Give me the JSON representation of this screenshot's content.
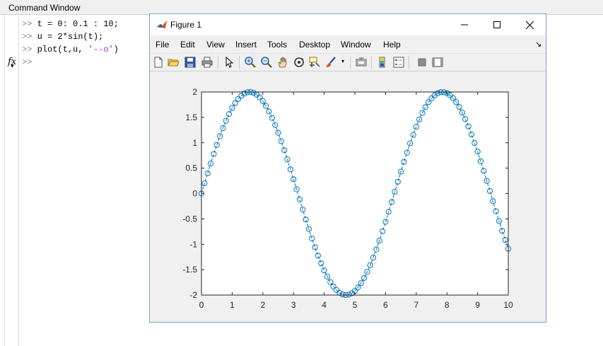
{
  "command_window": {
    "title": "Command Window",
    "prompt": ">>",
    "lines": [
      {
        "code": "t = 0: 0.1 : 10;",
        "code_pre": "",
        "string_part": "",
        "code_post": ""
      },
      {
        "code": "u = 2*sin(t);",
        "code_pre": "",
        "string_part": "",
        "code_post": ""
      },
      {
        "code": "",
        "code_pre": "plot(t,u, ",
        "string_part": "'--o'",
        "code_post": ")"
      }
    ],
    "fx_label": "fx"
  },
  "figure": {
    "title": "Figure 1",
    "menu": [
      "File",
      "Edit",
      "View",
      "Insert",
      "Tools",
      "Desktop",
      "Window",
      "Help"
    ],
    "toolbar_icons": [
      "new-figure-icon",
      "open-file-icon",
      "save-icon",
      "print-icon",
      "edit-plot-arrow-icon",
      "zoom-in-icon",
      "zoom-out-icon",
      "pan-hand-icon",
      "rotate-3d-icon",
      "data-cursor-icon",
      "brush-icon",
      "link-plot-icon",
      "insert-colorbar-icon",
      "insert-legend-icon",
      "hide-plot-tools-icon",
      "show-plot-tools-icon"
    ],
    "colors": {
      "line": "#0072bd",
      "axes_bg": "#ffffff",
      "figure_bg": "#f0f0f0"
    }
  },
  "chart_data": {
    "type": "line",
    "title": "",
    "xlabel": "",
    "ylabel": "",
    "xlim": [
      0,
      10
    ],
    "ylim": [
      -2,
      2
    ],
    "x_ticks": [
      "0",
      "1",
      "2",
      "3",
      "4",
      "5",
      "6",
      "7",
      "8",
      "9",
      "10"
    ],
    "y_ticks": [
      "2",
      "1.5",
      "1",
      "0.5",
      "0",
      "-0.5",
      "-1",
      "-1.5",
      "-2"
    ],
    "line_style": "dashed",
    "marker": "circle",
    "grid": false,
    "series": [
      {
        "x": [
          0,
          0.1,
          0.2,
          0.3,
          0.4,
          0.5,
          0.6,
          0.7,
          0.8,
          0.9,
          1,
          1.1,
          1.2,
          1.3,
          1.4,
          1.5,
          1.6,
          1.7,
          1.8,
          1.9,
          2,
          2.1,
          2.2,
          2.3,
          2.4,
          2.5,
          2.6,
          2.7,
          2.8,
          2.9,
          3,
          3.1,
          3.2,
          3.3,
          3.4,
          3.5,
          3.6,
          3.7,
          3.8,
          3.9,
          4,
          4.1,
          4.2,
          4.3,
          4.4,
          4.5,
          4.6,
          4.7,
          4.8,
          4.9,
          5,
          5.1,
          5.2,
          5.3,
          5.4,
          5.5,
          5.6,
          5.7,
          5.8,
          5.9,
          6,
          6.1,
          6.2,
          6.3,
          6.4,
          6.5,
          6.6,
          6.7,
          6.8,
          6.9,
          7,
          7.1,
          7.2,
          7.3,
          7.4,
          7.5,
          7.6,
          7.7,
          7.8,
          7.9,
          8,
          8.1,
          8.2,
          8.3,
          8.4,
          8.5,
          8.6,
          8.7,
          8.8,
          8.9,
          9,
          9.1,
          9.2,
          9.3,
          9.4,
          9.5,
          9.6,
          9.7,
          9.8,
          9.9,
          10
        ],
        "y": [
          0,
          0.2,
          0.397,
          0.591,
          0.779,
          0.959,
          1.129,
          1.288,
          1.435,
          1.567,
          1.683,
          1.782,
          1.864,
          1.927,
          1.971,
          1.995,
          1.999,
          1.983,
          1.948,
          1.893,
          1.819,
          1.726,
          1.617,
          1.491,
          1.351,
          1.197,
          1.031,
          0.855,
          0.67,
          0.478,
          0.282,
          0.083,
          -0.117,
          -0.315,
          -0.511,
          -0.702,
          -0.885,
          -1.06,
          -1.224,
          -1.375,
          -1.514,
          -1.636,
          -1.743,
          -1.832,
          -1.903,
          -1.955,
          -1.987,
          -2,
          -1.992,
          -1.965,
          -1.918,
          -1.851,
          -1.766,
          -1.664,
          -1.545,
          -1.411,
          -1.262,
          -1.101,
          -0.928,
          -0.746,
          -0.558,
          -0.363,
          -0.166,
          0.034,
          0.233,
          0.43,
          0.623,
          0.809,
          0.988,
          1.156,
          1.314,
          1.459,
          1.588,
          1.702,
          1.799,
          1.876,
          1.935,
          1.976,
          1.996,
          1.996,
          1.977,
          1.937,
          1.879,
          1.802,
          1.706,
          1.593,
          1.465,
          1.321,
          1.162,
          0.994,
          0.824,
          0.636,
          0.446,
          0.248,
          0.049,
          -0.151,
          -0.349,
          -0.543,
          -0.733,
          -0.914,
          -1.088
        ]
      }
    ]
  }
}
